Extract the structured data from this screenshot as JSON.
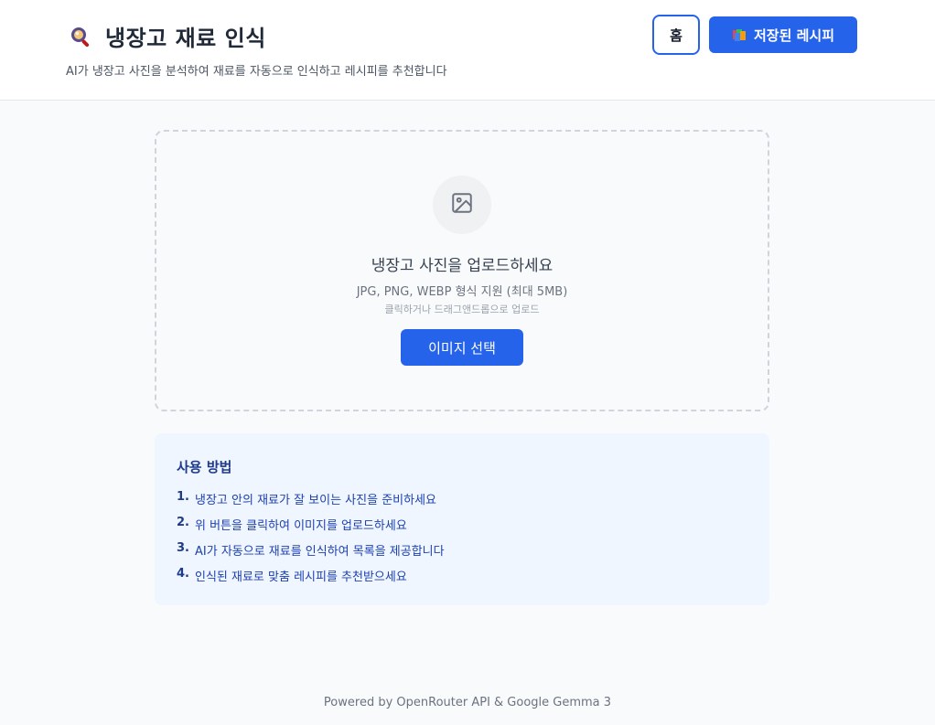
{
  "header": {
    "title": "냉장고 재료 인식",
    "subtitle": "AI가 냉장고 사진을 분석하여 재료를 자동으로 인식하고 레시피를 추천합니다",
    "logo_icon": "magnifier-icon",
    "home_label": "홈",
    "saved_label": "저장된 레시피",
    "saved_icon": "books-icon"
  },
  "upload": {
    "icon": "image-icon",
    "heading": "냉장고 사진을 업로드하세요",
    "formats": "JPG, PNG, WEBP 형식 지원 (최대 5MB)",
    "hint": "클릭하거나 드래그앤드롭으로 업로드",
    "button_label": "이미지 선택"
  },
  "howto": {
    "title": "사용 방법",
    "steps": [
      {
        "num": "1.",
        "text": "냉장고 안의 재료가 잘 보이는 사진을 준비하세요"
      },
      {
        "num": "2.",
        "text": "위 버튼을 클릭하여 이미지를 업로드하세요"
      },
      {
        "num": "3.",
        "text": "AI가 자동으로 재료를 인식하여 목록을 제공합니다"
      },
      {
        "num": "4.",
        "text": "인식된 재료로 맞춤 레시피를 추천받으세요"
      }
    ]
  },
  "footer": {
    "text": "Powered by OpenRouter API & Google Gemma 3"
  },
  "colors": {
    "accent": "#2563eb",
    "howto_bg": "#eff6ff",
    "howto_text": "#1e40af"
  }
}
